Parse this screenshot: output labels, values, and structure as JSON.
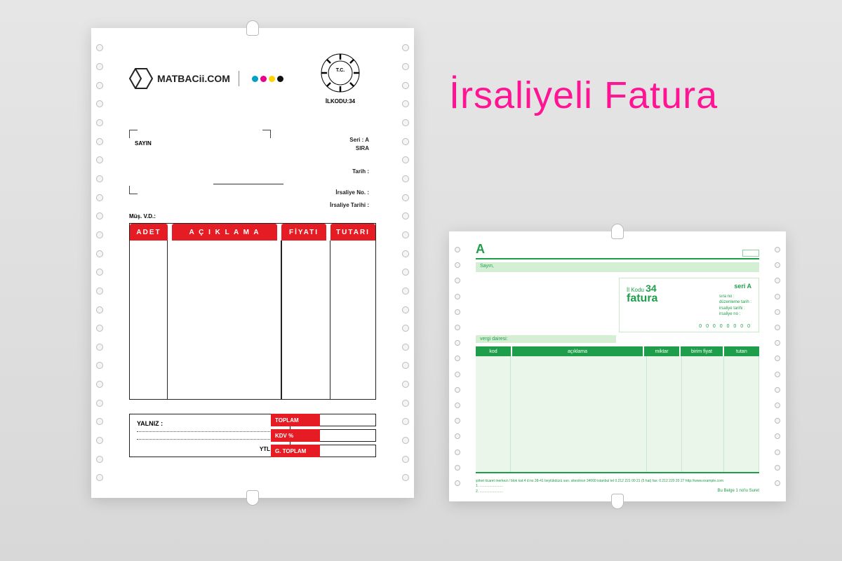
{
  "title": "İrsaliyeli Fatura",
  "sheet1": {
    "brand": "MATBACii.COM",
    "stamp_sub": "İLKODU:34",
    "sayin": "SAYIN",
    "meta": {
      "seri_lbl": "Seri : A",
      "sira_lbl": "SIRA",
      "tarih_lbl": "Tarih :",
      "irsaliye_no_lbl": "İrsaliye No. :",
      "irsaliye_tarih_lbl": "İrsaliye Tarihi :"
    },
    "vd": "Müş. V.D.:",
    "columns": {
      "c1": "ADET",
      "c2": "A Ç I K L A M A",
      "c3": "FİYATI",
      "c4": "TUTARI"
    },
    "yalniz": "YALNIZ :",
    "ytl": "YTL 'dir.",
    "totals": {
      "t1": "TOPLAM",
      "t2": "KDV %",
      "t3": "G. TOPLAM"
    }
  },
  "sheet2": {
    "a": "A",
    "sayin": "Sayın,",
    "ilkodu_lbl": "İl Kodu",
    "ilkodu_val": "34",
    "fatura": "fatura",
    "seri": "seri A",
    "meta_lines": "sıra no :\ndüzenleme tarih :\nirsaliye tarihi :\nirsaliye no :",
    "digits": "0 0 0 0 0 0 0 0",
    "vergi": "vergi dairesi:",
    "columns": {
      "c1": "kod",
      "c2": "açıklama",
      "c3": "miktar",
      "c4": "birim fiyat",
      "c5": "tutarı"
    },
    "footer_addr": "şirket ticaret merkezi / blok kat:4 d:no 38-41 beylükdüzü san. sitesi/esn 34000 istanbul tel 0.212 221 00 21 (5 hat) fax: 0.212 220 20 27 http://www.example.com",
    "footer_notes": "1. ........................\n2. ........................",
    "footer_right": "Bu Belge 1 no'lu Suret"
  }
}
